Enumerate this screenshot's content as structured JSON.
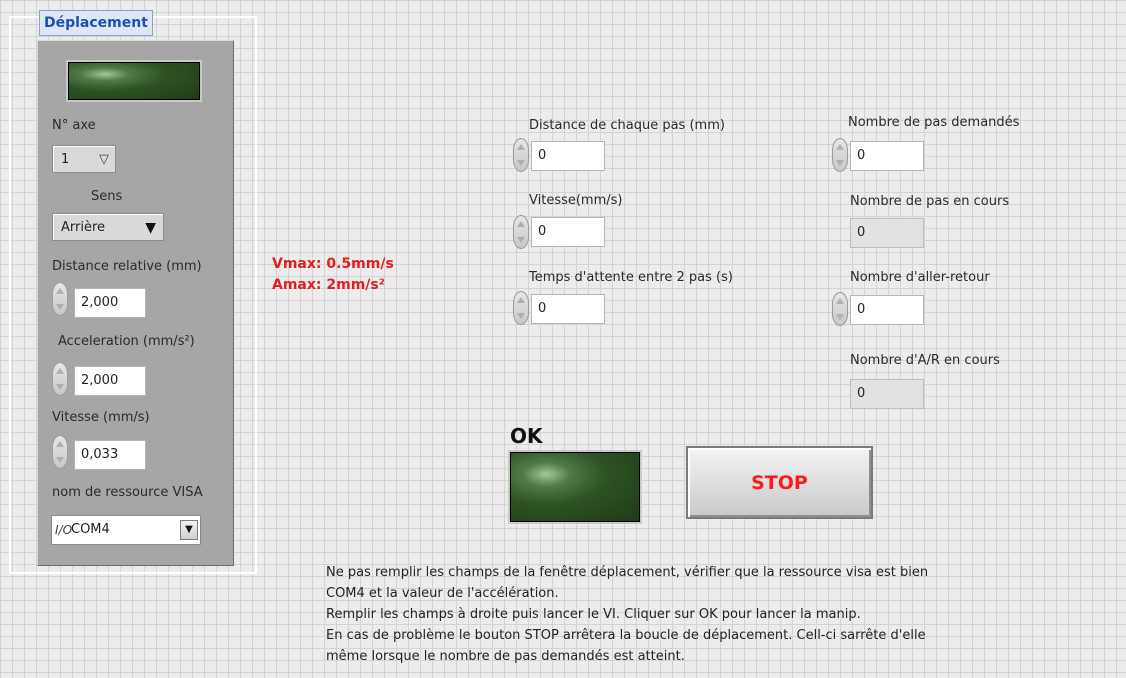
{
  "cluster": {
    "title": "Déplacement",
    "axis_label": "N° axe",
    "axis_value": "1",
    "sens_label": "Sens",
    "sens_value": "Arrière",
    "distance_label": "Distance relative (mm)",
    "distance_value": "2,000",
    "accel_label": "Acceleration (mm/s²)",
    "accel_value": "2,000",
    "speed_label": "Vitesse (mm/s)",
    "speed_value": "0,033",
    "visa_label": "nom de ressource VISA",
    "visa_value": "COM4",
    "visa_icon": "I/O"
  },
  "limits": {
    "vmax": "Vmax: 0.5mm/s",
    "amax": "Amax: 2mm/s²"
  },
  "controls": {
    "step_distance_label": "Distance de chaque pas (mm)",
    "step_distance_value": "0",
    "speed_label": "Vitesse(mm/s)",
    "speed_value": "0",
    "wait_label": "Temps d'attente entre 2 pas (s)",
    "wait_value": "0",
    "steps_requested_label": "Nombre de pas demandés",
    "steps_requested_value": "0",
    "steps_current_label": "Nombre de pas en cours",
    "steps_current_value": "0",
    "round_trips_label": "Nombre d'aller-retour",
    "round_trips_value": "0",
    "round_trips_current_label": "Nombre d'A/R en cours",
    "round_trips_current_value": "0"
  },
  "buttons": {
    "ok_label": "OK",
    "stop_label": "STOP"
  },
  "instructions": [
    "Ne pas remplir les champs de la fenêtre déplacement, vérifier que la ressource visa est bien",
    "COM4 et la valeur de l'accélération.",
    "Remplir les champs à droite puis lancer le VI. Cliquer sur OK pour lancer la manip.",
    "En cas de problème le bouton STOP arrêtera la boucle de déplacement. Cell-ci sarrête d'elle",
    "même lorsque le nombre de pas demandés est atteint."
  ],
  "colors": {
    "panel_bg": "#ececec",
    "cluster_bg": "#a6a6a6",
    "title_text": "#1c4fb0",
    "warning_red": "#e01e1e",
    "stop_text": "#ff1a1a",
    "led_green": "#2d5223"
  },
  "icons": [
    "spin-arrows-icon",
    "dropdown-arrow-icon",
    "visa-resource-icon"
  ]
}
